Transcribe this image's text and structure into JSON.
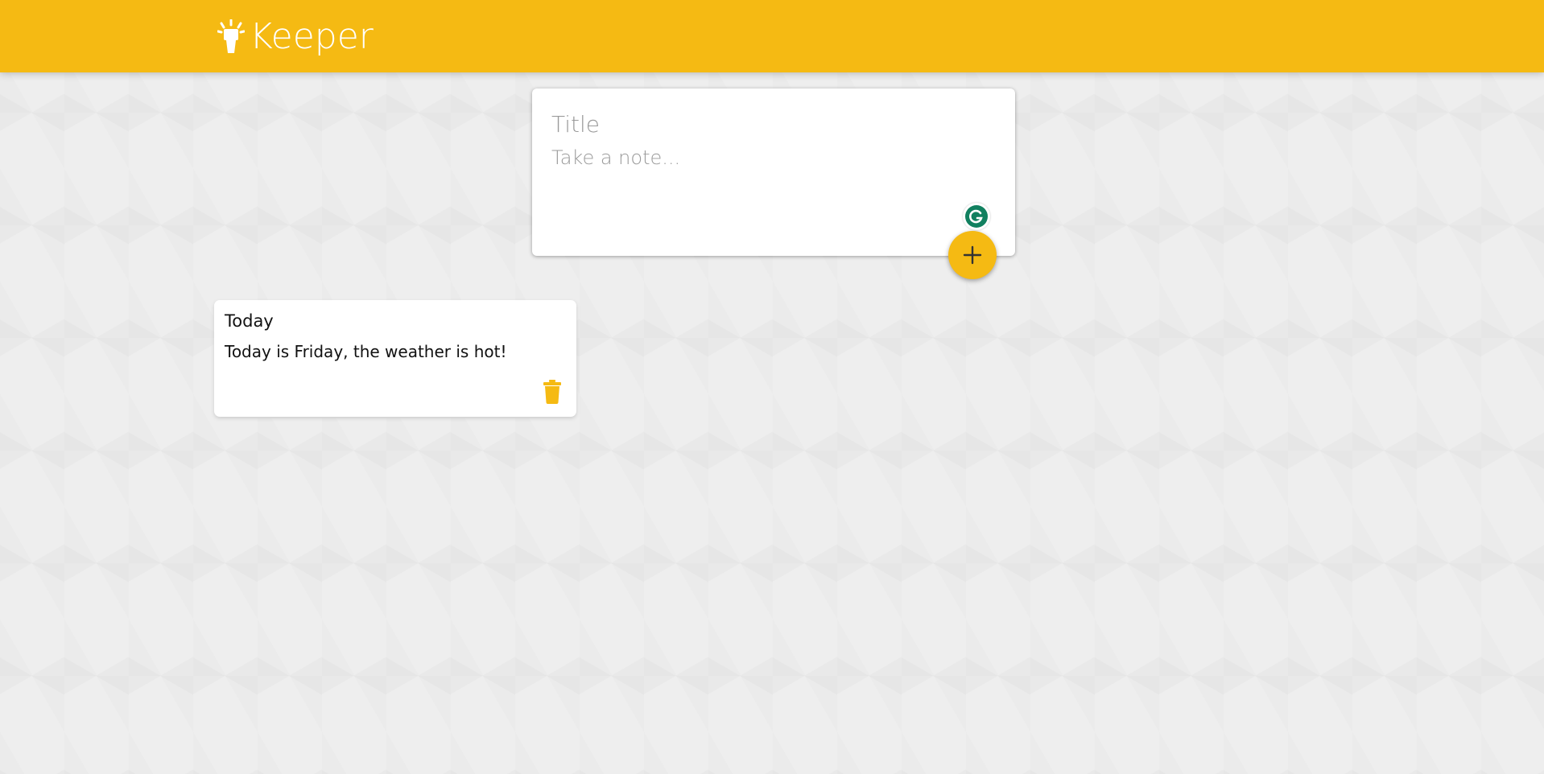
{
  "app": {
    "title": "Keeper",
    "brand_color": "#f5ba13"
  },
  "create_note": {
    "title_placeholder": "Title",
    "content_placeholder": "Take a note...",
    "add_button_icon": "plus-icon"
  },
  "grammarly_badge": {
    "icon": "grammarly-icon"
  },
  "notes": [
    {
      "title": "Today",
      "content": "Today is Friday, the weather is hot!",
      "delete_icon": "trash-icon"
    }
  ]
}
